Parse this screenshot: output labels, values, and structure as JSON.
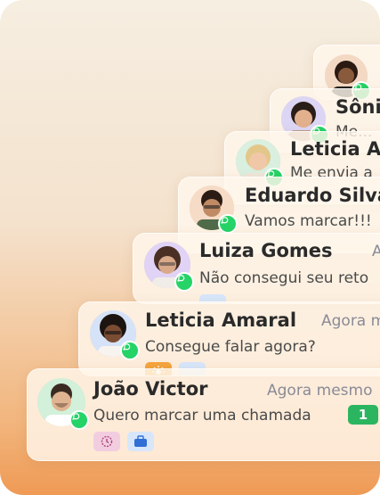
{
  "cards": [
    {
      "name": "Sônia",
      "message": "Me..."
    },
    {
      "name": "Leticia Ar",
      "message": "Me envia a"
    },
    {
      "name": "Eduardo Silva",
      "message": "Vamos marcar!!!"
    },
    {
      "name": "Luiza Gomes",
      "message": "Não consegui seu reto",
      "time": "A"
    },
    {
      "name": "Leticia Amaral",
      "message": "Consegue falar agora?",
      "time": "Agora m"
    },
    {
      "name": "João Victor",
      "message": "Quero marcar uma chamada",
      "time": "Agora mesmo",
      "unread": "1"
    }
  ],
  "icons": {
    "status": "whatsapp-icon",
    "tags": [
      "clock-icon",
      "briefcase-icon",
      "sun-icon"
    ]
  },
  "colors": {
    "whatsapp": "#25d366",
    "unread_badge": "#2bb560",
    "accent_gradient_end": "#ef9a55"
  }
}
